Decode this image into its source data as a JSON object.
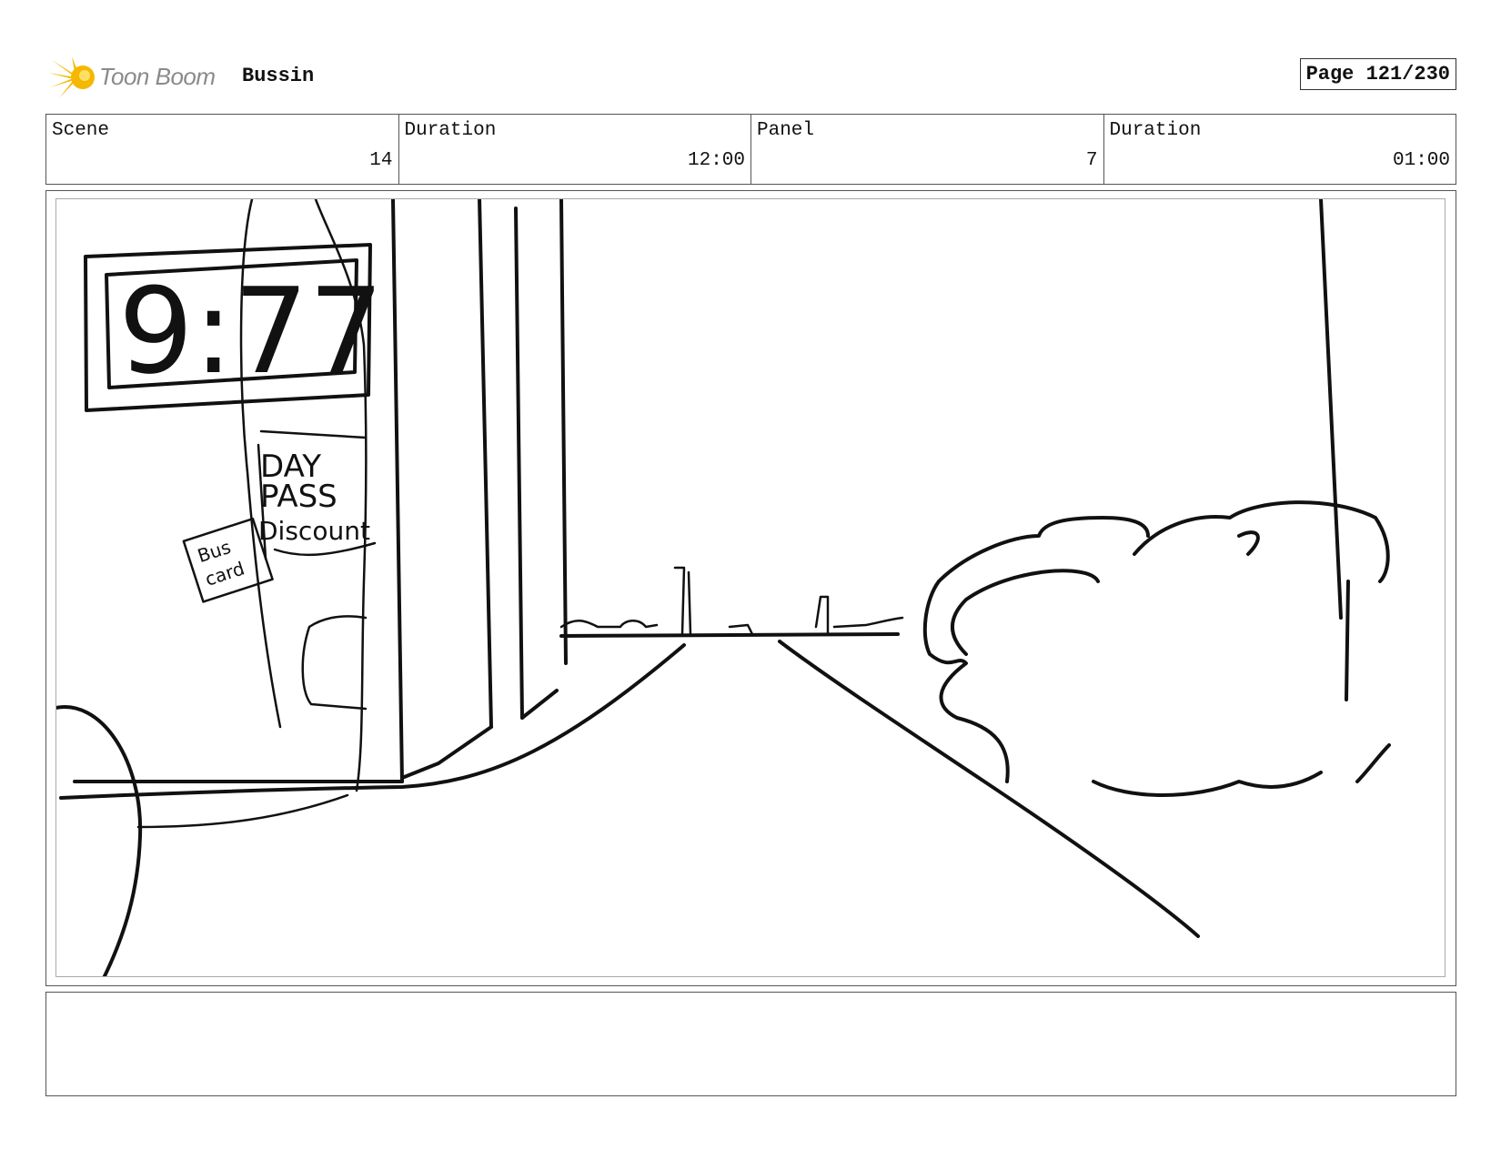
{
  "header": {
    "logo_text": "Toon Boom",
    "project_title": "Bussin",
    "page_label": "Page 121/230"
  },
  "info": {
    "scene_label": "Scene",
    "scene_value": "14",
    "scene_duration_label": "Duration",
    "scene_duration_value": "12:00",
    "panel_label": "Panel",
    "panel_value": "7",
    "panel_duration_label": "Duration",
    "panel_duration_value": "01:00"
  },
  "sketch": {
    "clock_text": "9:77",
    "sign_line1": "DAY",
    "sign_line2": "PASS",
    "sign_line3": "Discount",
    "card_line1": "Bus",
    "card_line2": "card"
  },
  "colors": {
    "logo_accent": "#f5b800",
    "line": "#111111"
  }
}
